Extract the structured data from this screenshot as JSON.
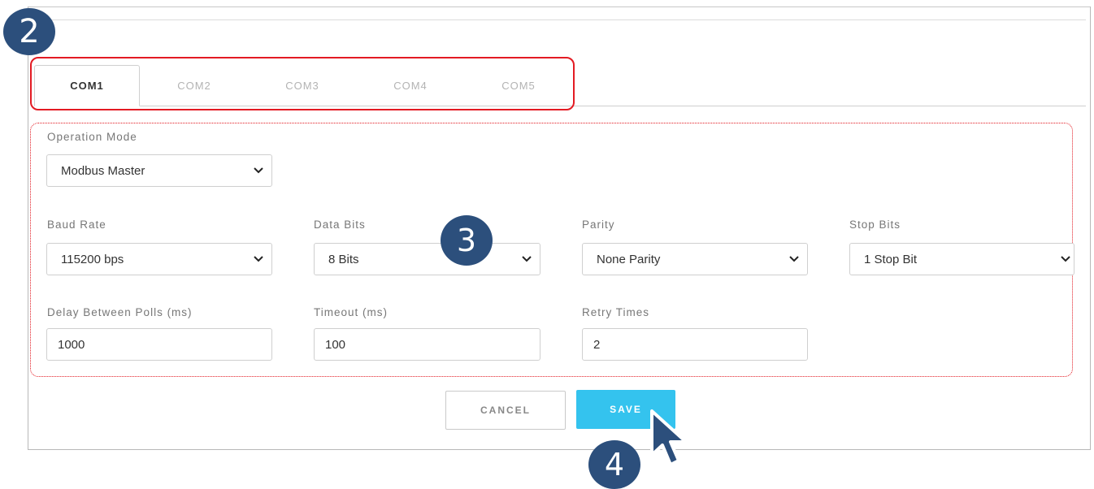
{
  "callouts": {
    "tabs_step": "2",
    "form_step": "3",
    "save_step": "4"
  },
  "tabs": [
    {
      "label": "COM1",
      "active": true
    },
    {
      "label": "COM2",
      "active": false
    },
    {
      "label": "COM3",
      "active": false
    },
    {
      "label": "COM4",
      "active": false
    },
    {
      "label": "COM5",
      "active": false
    }
  ],
  "form": {
    "operation_mode": {
      "label": "Operation Mode",
      "value": "Modbus Master"
    },
    "baud_rate": {
      "label": "Baud Rate",
      "value": "115200 bps"
    },
    "data_bits": {
      "label": "Data Bits",
      "value": "8 Bits"
    },
    "parity": {
      "label": "Parity",
      "value": "None Parity"
    },
    "stop_bits": {
      "label": "Stop Bits",
      "value": "1 Stop Bit"
    },
    "delay_between_polls": {
      "label": "Delay Between Polls (ms)",
      "value": "1000"
    },
    "timeout": {
      "label": "Timeout (ms)",
      "value": "100"
    },
    "retry_times": {
      "label": "Retry Times",
      "value": "2"
    }
  },
  "actions": {
    "cancel_label": "CANCEL",
    "save_label": "SAVE"
  },
  "colors": {
    "accent": "#34c3ee",
    "highlight": "#e31b23",
    "badge": "#2c4f7c"
  }
}
